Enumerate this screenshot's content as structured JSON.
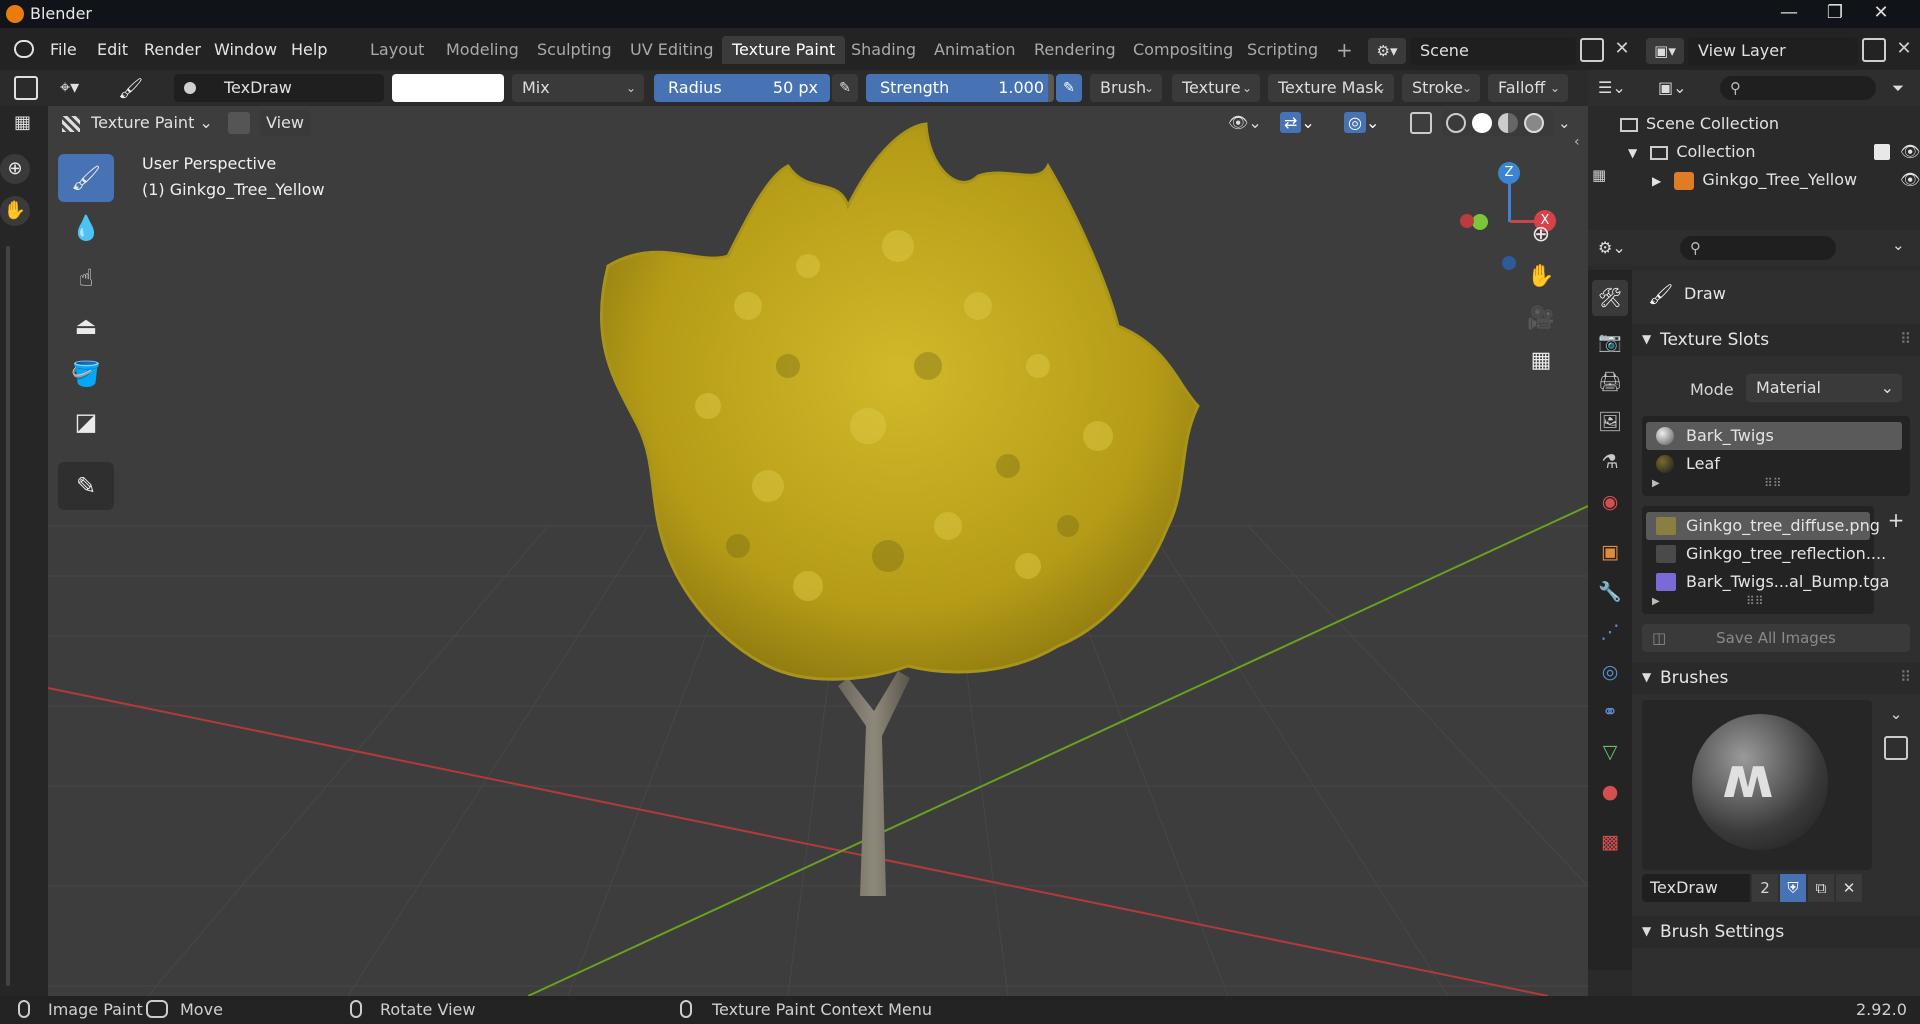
{
  "window": {
    "title": "Blender",
    "minimize": "—",
    "restore": "❐",
    "close": "✕"
  },
  "menu": [
    "File",
    "Edit",
    "Render",
    "Window",
    "Help"
  ],
  "workspace_tabs": [
    "Layout",
    "Modeling",
    "Sculpting",
    "UV Editing",
    "Texture Paint",
    "Shading",
    "Animation",
    "Rendering",
    "Compositing",
    "Scripting"
  ],
  "active_tab": "Texture Paint",
  "add_tab": "+",
  "scene": {
    "label": "Scene",
    "view_layer": "View Layer"
  },
  "toolheader": {
    "brush_name": "TexDraw",
    "blend_mode": "Mix",
    "radius_label": "Radius",
    "radius_value": "50 px",
    "strength_label": "Strength",
    "strength_value": "1.000",
    "strength_fill": 0.97,
    "menus": [
      "Brush",
      "Texture",
      "Texture Mask",
      "Stroke",
      "Falloff"
    ]
  },
  "viewheader": {
    "mode": "Texture Paint",
    "view": "View"
  },
  "viewport": {
    "perspective": "User Perspective",
    "object": "(1) Ginkgo_Tree_Yellow",
    "gizmo": {
      "z": "Z",
      "x": "X"
    }
  },
  "outliner": {
    "scene_collection": "Scene Collection",
    "collection": "Collection",
    "object": "Ginkgo_Tree_Yellow"
  },
  "properties": {
    "tool_name": "Draw",
    "texture_slots_title": "Texture Slots",
    "mode_label": "Mode",
    "mode_value": "Material",
    "materials": [
      "Bark_Twigs",
      "Leaf"
    ],
    "images": [
      "Ginkgo_tree_diffuse.png",
      "Ginkgo_tree_reflection....",
      "Bark_Twigs...al_Bump.tga"
    ],
    "save_all": "Save All Images",
    "brushes_title": "Brushes",
    "brush_name": "TexDraw",
    "brush_users": "2",
    "brush_settings_title": "Brush Settings"
  },
  "statusbar": {
    "left_action": "Image Paint",
    "middle_action": "Move",
    "rotate": "Rotate View",
    "context": "Texture Paint Context Menu",
    "version": "2.92.0"
  },
  "colors": {
    "accent": "#4772b3",
    "leaf": "#c9b21c",
    "x_axis": "#b33a3a",
    "y_axis": "#6aa11f"
  }
}
